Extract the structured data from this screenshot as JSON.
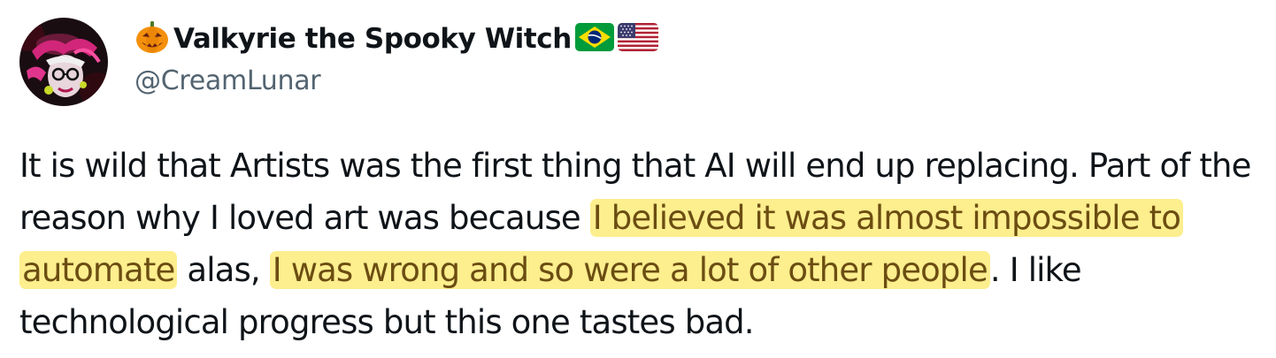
{
  "tweet": {
    "author": {
      "name_prefix_emoji": "jack-o-lantern-icon",
      "display_name": "Valkyrie the Spooky Witch",
      "flags": [
        "brazil-flag-icon",
        "usa-flag-icon"
      ],
      "handle": "@CreamLunar"
    },
    "body": {
      "part1": "It is wild that Artists was the first thing that AI will end up replacing. Part of the reason why I loved art was because ",
      "highlight1": "I believed it was almost impossible to automate",
      "part2": " alas, ",
      "highlight2": "I was wrong and so were a lot of other people",
      "part3": ". I like technological progress but this one tastes bad."
    },
    "colors": {
      "text": "#0f1419",
      "secondary": "#536471",
      "highlight_bg": "#fdee8e",
      "highlight_text": "#6b4d12"
    }
  }
}
